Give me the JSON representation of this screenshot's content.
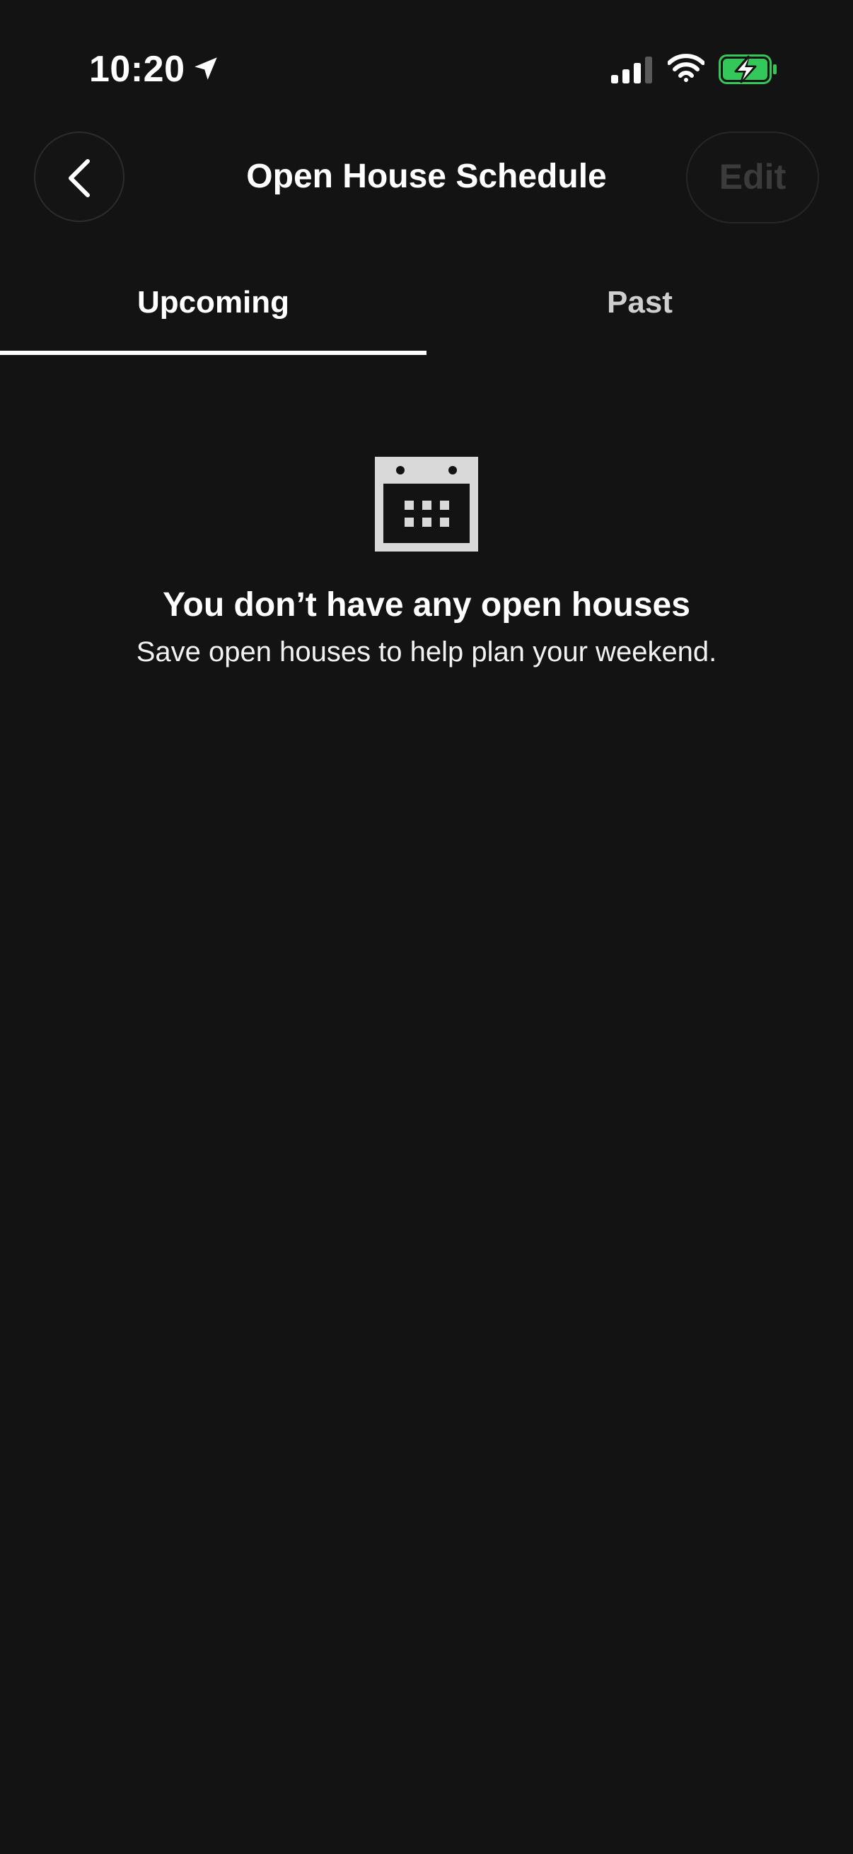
{
  "status_bar": {
    "time": "10:20",
    "icons": [
      "location-arrow-icon",
      "cellular-signal-icon",
      "wifi-icon",
      "battery-charging-icon"
    ],
    "battery_color": "#34c759"
  },
  "header": {
    "back_icon": "chevron-left-icon",
    "title": "Open House Schedule",
    "edit_label": "Edit"
  },
  "tabs": [
    {
      "label": "Upcoming",
      "selected": true
    },
    {
      "label": "Past",
      "selected": false
    }
  ],
  "empty_state": {
    "icon": "calendar-icon",
    "title": "You don’t have any open houses",
    "subtitle": "Save open houses to help plan your weekend."
  },
  "colors": {
    "background": "#131313",
    "text": "#ffffff",
    "disabled_text": "#3b3b3b",
    "icon_gray": "#d9d9d9"
  }
}
